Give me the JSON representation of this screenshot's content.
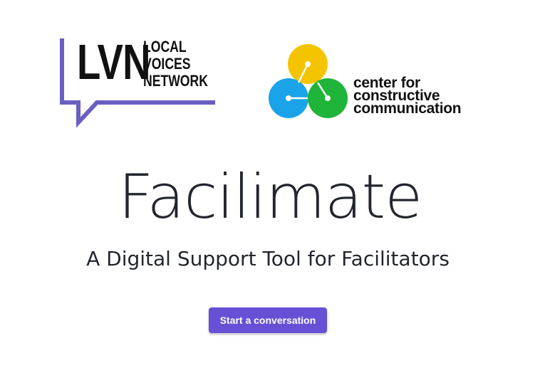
{
  "logos": {
    "lvn": {
      "letters": "LVN",
      "line1": "LOCAL",
      "line2": "VOICES",
      "line3": "NETWORK",
      "frame_color": "#6a5fc1"
    },
    "ccc": {
      "line1": "center for",
      "line2": "constructive",
      "line3": "communication",
      "colors": {
        "top": "#f5c400",
        "left": "#1aa3e8",
        "right": "#1fb53a"
      }
    }
  },
  "hero": {
    "title": "Facilimate",
    "subtitle": "A Digital Support Tool for Facilitators"
  },
  "cta": {
    "label": "Start a conversation",
    "color": "#6750d6"
  }
}
